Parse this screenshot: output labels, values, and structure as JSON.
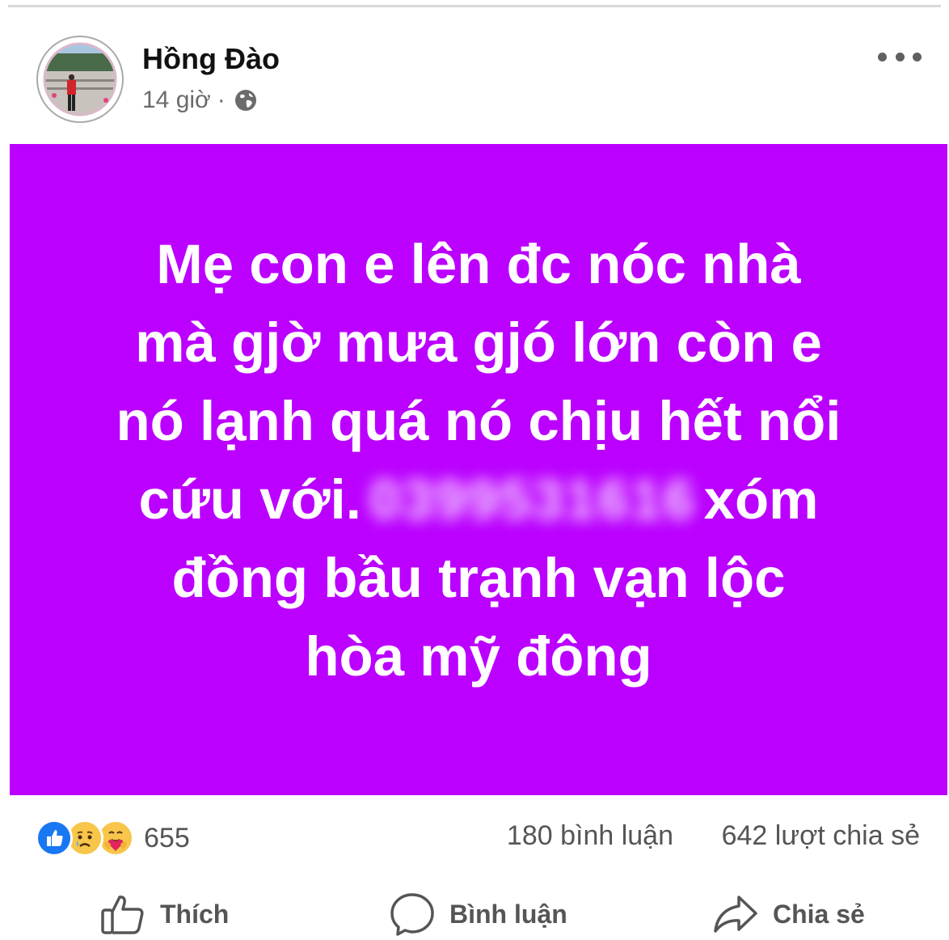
{
  "post": {
    "author": "Hồng Đào",
    "time": "14 giờ",
    "separator": "·",
    "privacy_icon": "globe-icon",
    "status_lines": [
      "Mẹ con e lên đc nóc nhà",
      "mà gjờ mưa gjó lớn còn e",
      "nó lạnh quá nó chịu hết nổi"
    ],
    "status_line4_prefix": "cứu với.",
    "status_line4_phone_blurred": "0399531616",
    "status_line4_suffix": "xóm",
    "status_lines_end": [
      "đồng bầu trạnh vạn lộc",
      "hòa mỹ đông"
    ],
    "background_color": "#bb00ff"
  },
  "reactions": {
    "icons": [
      "like-icon",
      "sad-icon",
      "care-icon"
    ],
    "count": "655"
  },
  "stats": {
    "comments": "180 bình luận",
    "shares": "642 lượt chia sẻ"
  },
  "actions": {
    "like_label": "Thích",
    "comment_label": "Bình luận",
    "share_label": "Chia sẻ"
  }
}
